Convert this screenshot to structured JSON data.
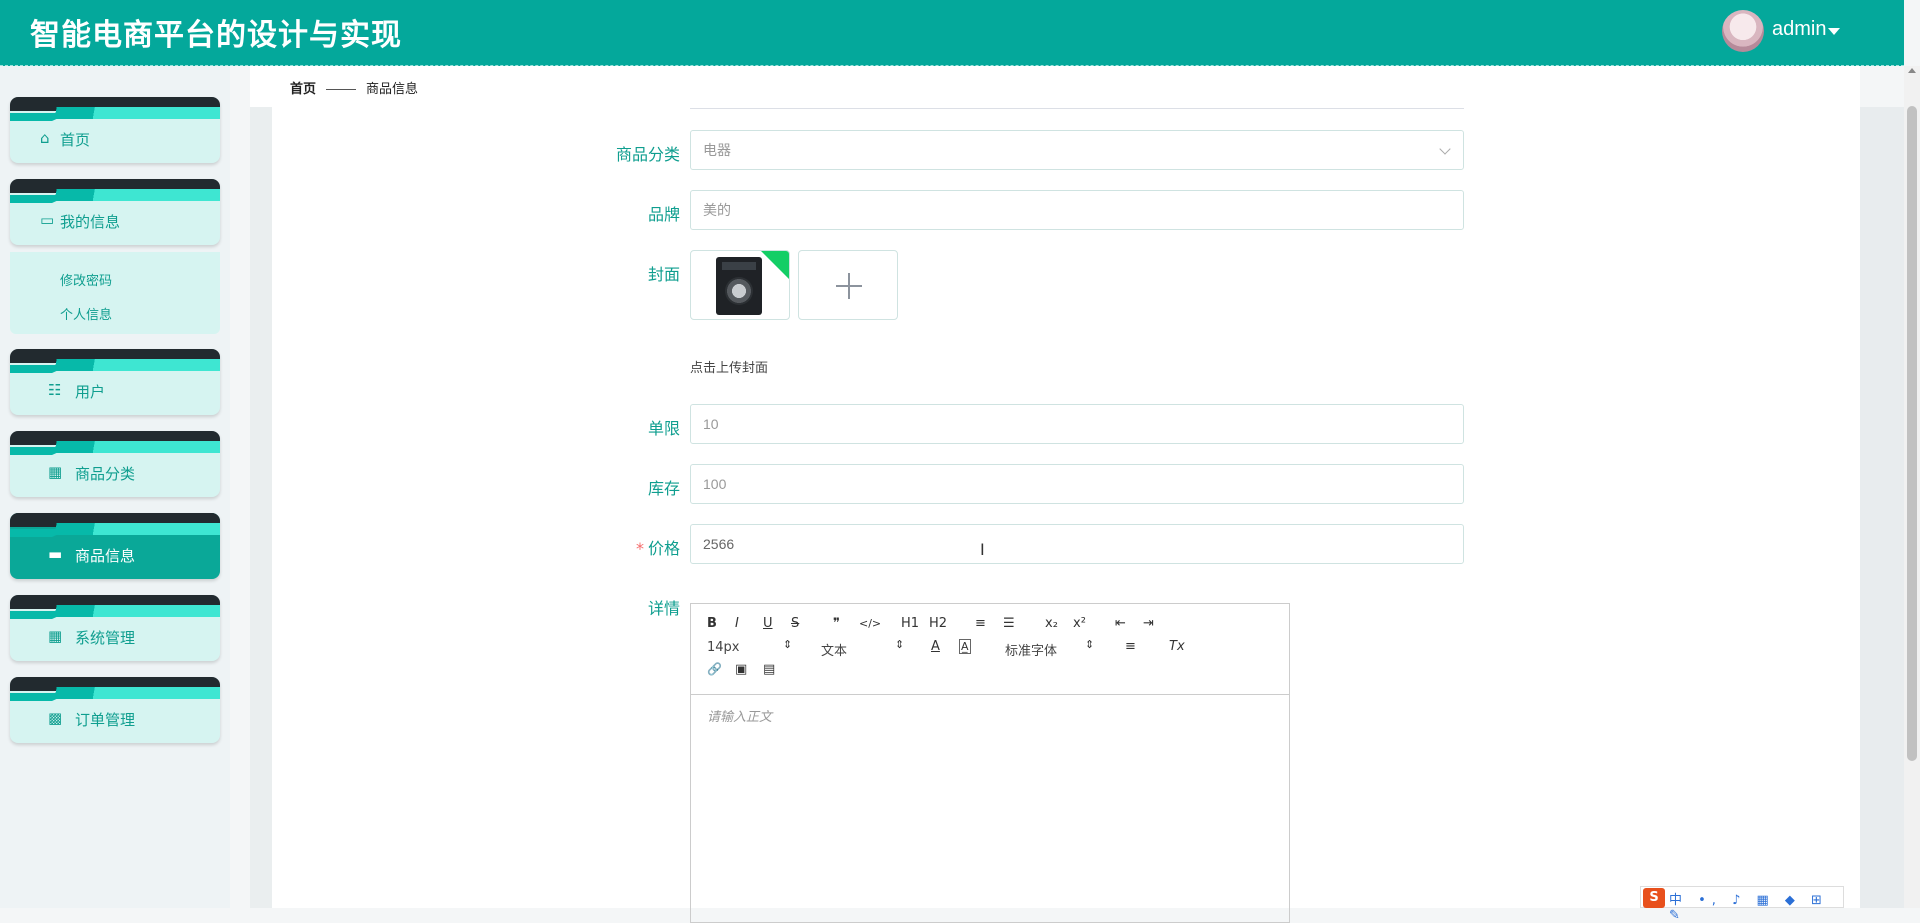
{
  "app": {
    "title": "智能电商平台的设计与实现",
    "user": "admin"
  },
  "sidebar": {
    "items": [
      {
        "label": "首页",
        "icon": "home-icon"
      },
      {
        "label": "我的信息",
        "icon": "card-icon"
      },
      {
        "label": "用户",
        "icon": "sliders-icon"
      },
      {
        "label": "商品分类",
        "icon": "grid-icon"
      },
      {
        "label": "商品信息",
        "icon": "briefcase-icon",
        "active": true
      },
      {
        "label": "系统管理",
        "icon": "grid-icon"
      },
      {
        "label": "订单管理",
        "icon": "grid9-icon"
      }
    ],
    "submenu": [
      "修改密码",
      "个人信息"
    ]
  },
  "breadcrumb": {
    "home": "首页",
    "current": "商品信息"
  },
  "form": {
    "category": {
      "label": "商品分类",
      "value": "电器"
    },
    "brand": {
      "label": "品牌",
      "value": "美的"
    },
    "cover": {
      "label": "封面",
      "tip": "点击上传封面"
    },
    "limit": {
      "label": "单限",
      "value": "10"
    },
    "stock": {
      "label": "库存",
      "value": "100"
    },
    "price": {
      "label": "价格",
      "required_mark": "*",
      "value": "2566"
    },
    "detail": {
      "label": "详情",
      "placeholder": "请输入正文"
    }
  },
  "editor": {
    "buttons": [
      "B",
      "I",
      "U",
      "S",
      "❞",
      "</>",
      "H1",
      "H2",
      "≡",
      "☰",
      "x₂",
      "x²",
      "⇤",
      "⇥"
    ],
    "font_size": "14px",
    "header_select": "文本",
    "font_family": "标准字体",
    "icons2": [
      "A",
      "A̲",
      "≡",
      "Tx"
    ],
    "icons3": [
      "🔗",
      "▣",
      "▤"
    ]
  },
  "ime": {
    "text": "中 •, ♪ ▦ ◆ ⊞ ✎"
  }
}
